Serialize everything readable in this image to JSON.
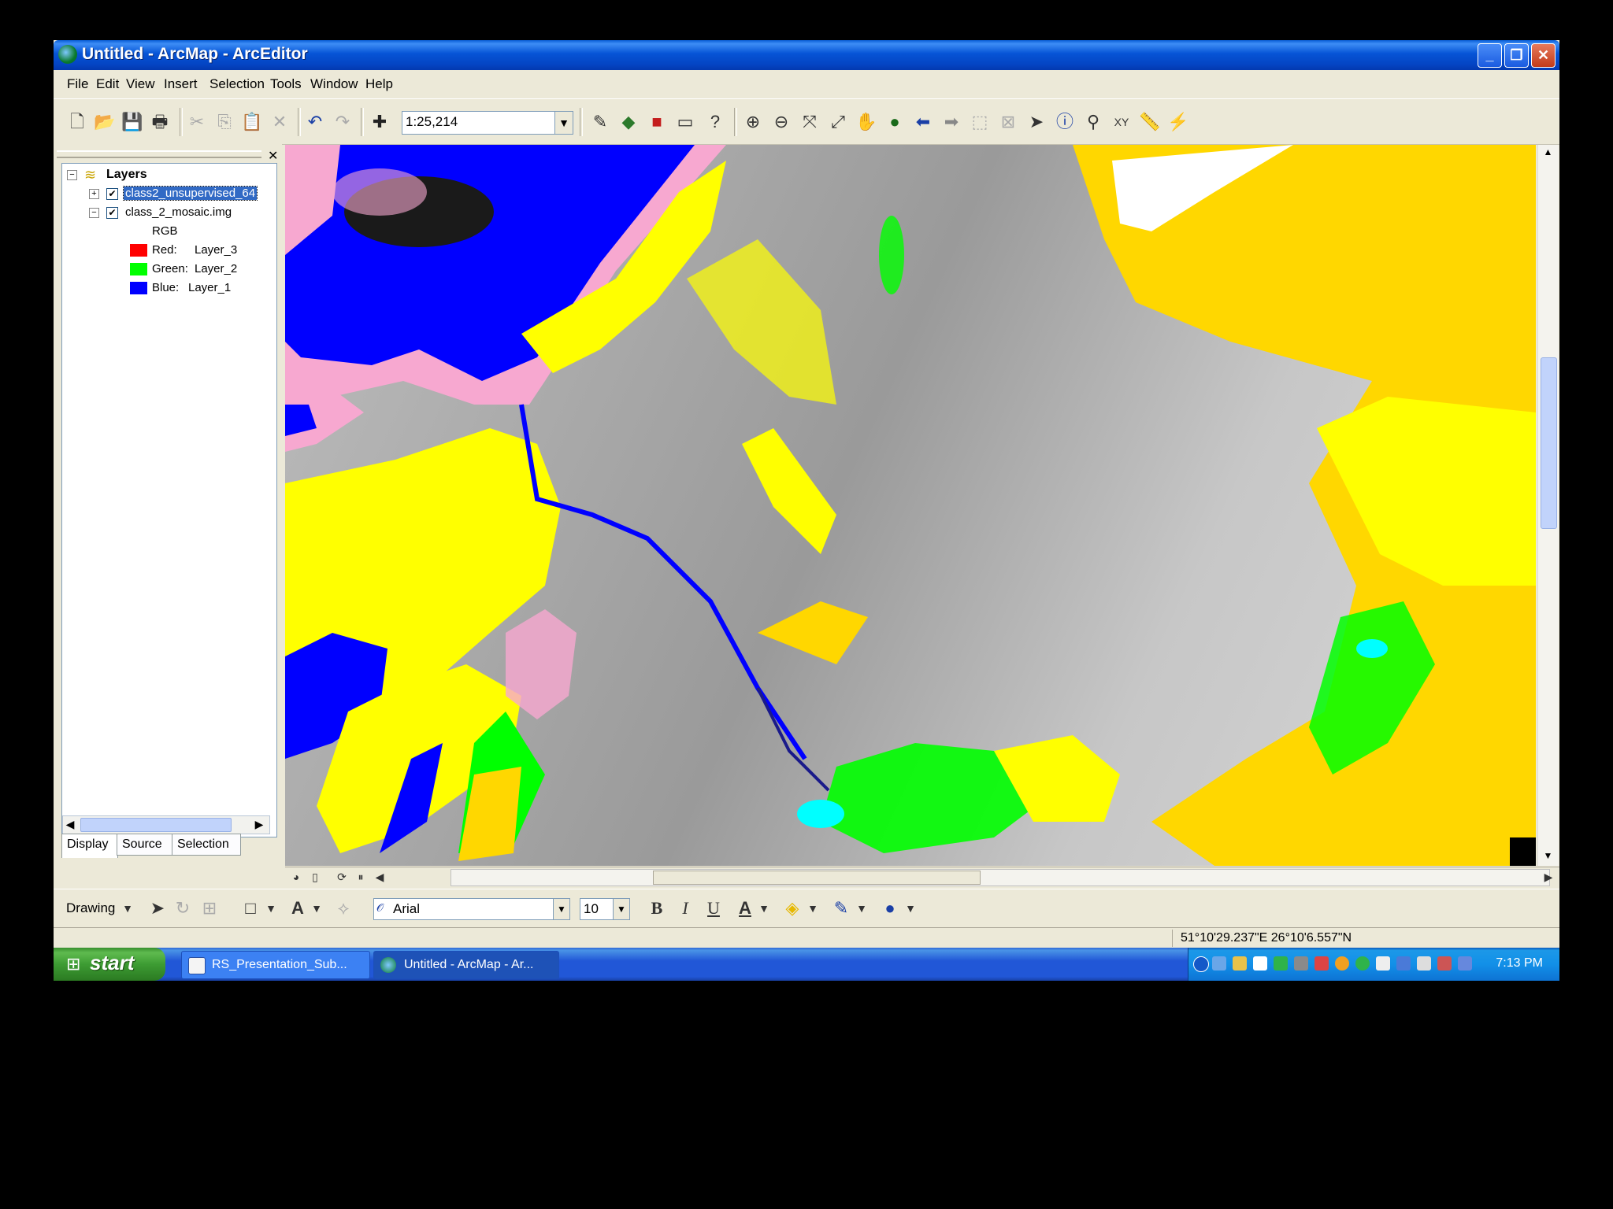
{
  "window": {
    "title": "Untitled - ArcMap - ArcEditor"
  },
  "menu": [
    "File",
    "Edit",
    "View",
    "Insert",
    "Selection",
    "Tools",
    "Window",
    "Help"
  ],
  "toolbar": {
    "scale": "1:25,214"
  },
  "toc": {
    "root": "Layers",
    "layers": [
      {
        "name": "class2_unsupervised_64",
        "checked": true,
        "selected": true
      },
      {
        "name": "class_2_mosaic.img",
        "checked": true,
        "selected": false
      }
    ],
    "rgb_label": "RGB",
    "bands": [
      {
        "label": "Red:",
        "value": "Layer_3",
        "color": "#ff0000"
      },
      {
        "label": "Green:",
        "value": "Layer_2",
        "color": "#00ff00"
      },
      {
        "label": "Blue:",
        "value": "Layer_1",
        "color": "#0000ff"
      }
    ],
    "tabs": [
      "Display",
      "Source",
      "Selection"
    ]
  },
  "drawing": {
    "label": "Drawing",
    "font": "Arial",
    "size": "10"
  },
  "status": {
    "coords": "51°10'29.237\"E  26°10'6.557\"N"
  },
  "taskbar": {
    "start": "start",
    "items": [
      "RS_Presentation_Sub...",
      "Untitled - ArcMap - Ar..."
    ],
    "clock": "7:13 PM"
  },
  "colors": {
    "map_yellow": "#ffff00",
    "map_gold": "#ffd700",
    "map_blue": "#0000ff",
    "map_pink": "#f7a8d0",
    "map_green": "#00ff00"
  }
}
